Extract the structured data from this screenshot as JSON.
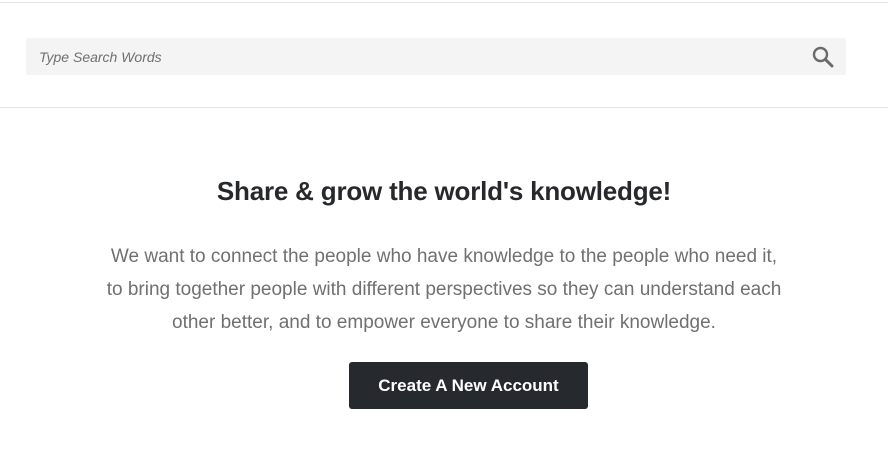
{
  "search": {
    "placeholder": "Type Search Words",
    "value": "",
    "icon": "search-icon"
  },
  "hero": {
    "title": "Share & grow the world's knowledge!",
    "description": "We want to connect the people who have knowledge to the people who need it, to bring together people with different perspectives so they can understand each other better, and to empower everyone to share their knowledge.",
    "cta_label": "Create A New Account"
  },
  "colors": {
    "button_background": "#26292e",
    "button_text": "#ffffff",
    "title_text": "#26282c",
    "body_text": "#707070",
    "search_background": "#f4f4f4"
  }
}
